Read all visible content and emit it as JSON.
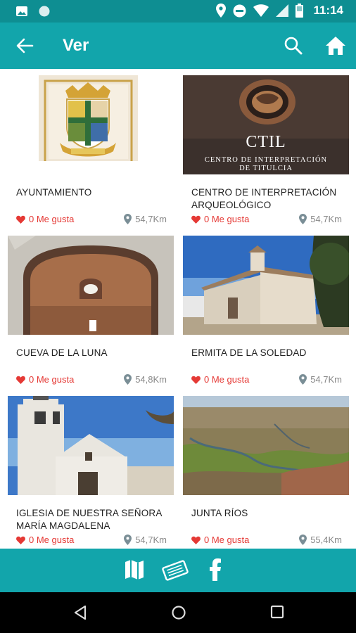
{
  "status": {
    "time": "11:14"
  },
  "appbar": {
    "title": "Ver"
  },
  "places": [
    {
      "name": "AYUNTAMIENTO",
      "likes": "0 Me gusta",
      "distance": "54,7Km"
    },
    {
      "name": "CENTRO DE INTERPRETACIÓN ARQUEOLÓGICO",
      "likes": "0 Me gusta",
      "distance": "54,7Km",
      "image_text_1": "CTIL",
      "image_text_2": "CENTRO DE INTERPRETACIÓN",
      "image_text_3": "DE TITULCIA"
    },
    {
      "name": "CUEVA DE LA LUNA",
      "likes": "0 Me gusta",
      "distance": "54,8Km"
    },
    {
      "name": "ERMITA DE LA SOLEDAD",
      "likes": "0 Me gusta",
      "distance": "54,7Km"
    },
    {
      "name": "IGLESIA DE NUESTRA SEÑORA MARÍA MAGDALENA",
      "likes": "0 Me gusta",
      "distance": "54,7Km"
    },
    {
      "name": "JUNTA RÍOS",
      "likes": "0 Me gusta",
      "distance": "55,4Km"
    }
  ],
  "colors": {
    "statusbar": "#0e8e92",
    "appbar": "#12a5ab",
    "like": "#e53935",
    "muted": "#888888"
  },
  "icons": [
    "back-arrow-icon",
    "search-icon",
    "home-icon",
    "map-icon",
    "ticket-icon",
    "facebook-icon",
    "heart-icon",
    "location-pin-icon"
  ]
}
